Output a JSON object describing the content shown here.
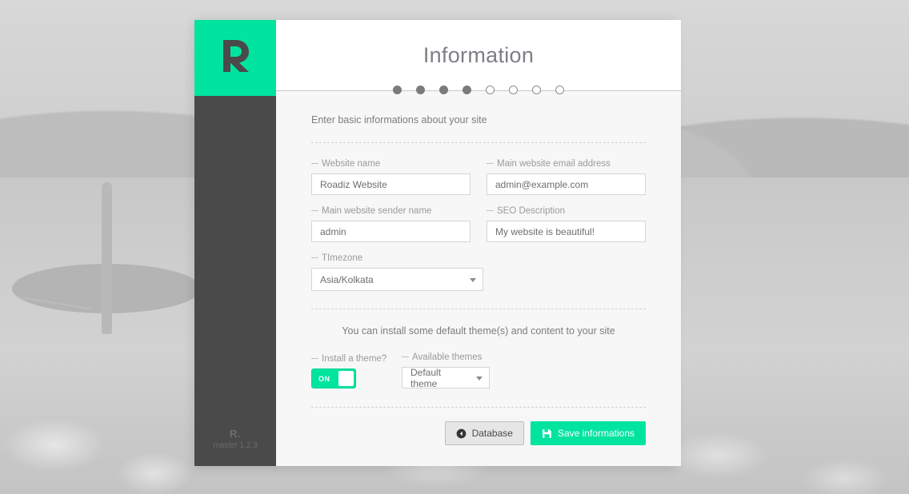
{
  "background": {
    "scene": "faded-beach-surfer-photo",
    "tint": "#d4d4d4"
  },
  "brand": {
    "accent_color": "#00e4a0",
    "sidebar_color": "#4a4a4a",
    "logo_icon": "roadiz-r-logo",
    "footer_mark": "R.",
    "version": "master 1.2.3"
  },
  "header": {
    "title": "Information"
  },
  "steps": {
    "total": 8,
    "completed": 4,
    "states": [
      "done",
      "done",
      "done",
      "done",
      "todo",
      "todo",
      "todo",
      "todo"
    ]
  },
  "main": {
    "intro": "Enter basic informations about your site",
    "fields": [
      {
        "id": "website-name",
        "label": "Website name",
        "value": "Roadiz Website",
        "placeholder": "Website name",
        "type": "text"
      },
      {
        "id": "main-website-email-address",
        "label": "Main website email address",
        "value": "admin@example.com",
        "placeholder": "Main website email address",
        "type": "text"
      },
      {
        "id": "main-website-sender-name",
        "label": "Main website sender name",
        "value": "admin",
        "placeholder": "Main website sender name",
        "type": "text"
      },
      {
        "id": "seo-description",
        "label": "SEO Description",
        "value": "My website is beautiful!",
        "placeholder": "SEO Description",
        "type": "text"
      },
      {
        "id": "timezone",
        "label": "TImezone",
        "value": "Asia/Kolkata",
        "type": "select"
      }
    ]
  },
  "theme": {
    "intro": "You can install some default theme(s) and content to your site",
    "toggle": {
      "label": "Install a theme?",
      "state_label": "ON",
      "enabled": true
    },
    "select": {
      "label": "Available themes",
      "value": "Default theme"
    }
  },
  "actions": {
    "back": {
      "label": "Database",
      "icon": "arrow-circle-left-icon"
    },
    "submit": {
      "label": "Save informations",
      "icon": "floppy-disk-save-icon"
    }
  }
}
